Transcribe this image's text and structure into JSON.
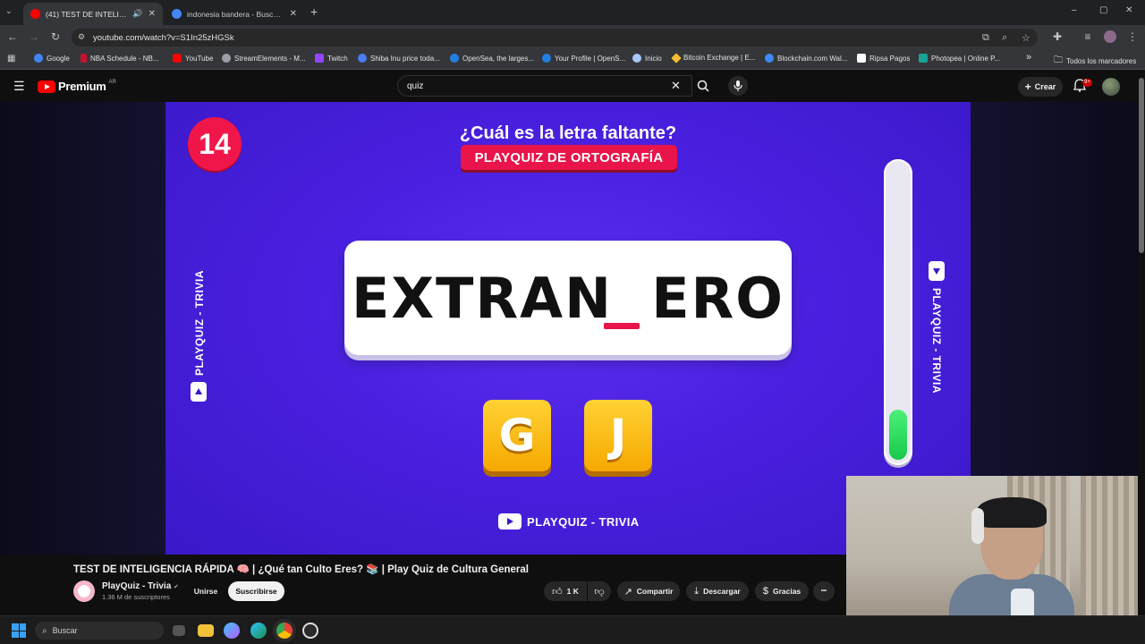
{
  "browser": {
    "tabs": [
      {
        "title": "(41) TEST DE INTELIGENCIA RÁPIDA",
        "active": true,
        "favicon_color": "#ff0000"
      },
      {
        "title": "indonesia bandera - Buscar con Google",
        "active": false,
        "favicon_color": "#4285f4"
      }
    ],
    "new_tab": "+",
    "window_controls": {
      "minimize": "–",
      "maximize": "▢",
      "close": "✕"
    },
    "url": "youtube.com/watch?v=S1In25zHGSk",
    "bookmarks": [
      {
        "label": "Google",
        "color": "#4285f4"
      },
      {
        "label": "NBA Schedule - NB...",
        "color": "#c8102e"
      },
      {
        "label": "YouTube",
        "color": "#ff0000"
      },
      {
        "label": "StreamElements - M...",
        "color": "#9aa0a6"
      },
      {
        "label": "Twitch",
        "color": "#9146ff"
      },
      {
        "label": "Shiba Inu price toda...",
        "color": "#4a7cf3"
      },
      {
        "label": "OpenSea, the larges...",
        "color": "#2081e2"
      },
      {
        "label": "Your Profile | OpenS...",
        "color": "#2081e2"
      },
      {
        "label": "Inicio",
        "color": "#a8c7fa"
      },
      {
        "label": "Bitcoin Exchange | E...",
        "color": "#f3ba2f"
      },
      {
        "label": "Blockchain.com Wal...",
        "color": "#3d89f5"
      },
      {
        "label": "Ripsa Pagos",
        "color": "#ffffff"
      },
      {
        "label": "Photopea | Online P...",
        "color": "#18a497"
      }
    ],
    "bookmarks_more": "»",
    "all_bookmarks": "Todos los marcadores"
  },
  "youtube": {
    "logo_text": "Premium",
    "country_code": "AR",
    "search_value": "quiz",
    "create_label": "Crear",
    "notifications_badge": "9+"
  },
  "video": {
    "question_number": "14",
    "question_title": "¿Cuál es la letra faltante?",
    "question_subtitle": "PLAYQUIZ DE ORTOGRAFÍA",
    "word": "EXTRAN_ERO",
    "options": [
      "G",
      "J"
    ],
    "brand_side": "PLAYQUIZ - TRIVIA",
    "brand_bottom": "PLAYQUIZ - TRIVIA",
    "timer_level": 0.17
  },
  "info": {
    "title": "TEST DE INTELIGENCIA RÁPIDA 🧠 | ¿Qué tan Culto Eres? 📚 | Play Quiz de Cultura General",
    "channel_name": "PlayQuiz - Trivia",
    "verified": "✔",
    "subscribers": "1.36 M de suscriptores",
    "join_label": "Unirse",
    "subscribe_label": "Suscribirse",
    "likes": "1 K",
    "share_label": "Compartir",
    "download_label": "Descargar",
    "thanks_label": "Gracias",
    "more": "•••"
  },
  "taskbar": {
    "search_placeholder": "Buscar"
  }
}
